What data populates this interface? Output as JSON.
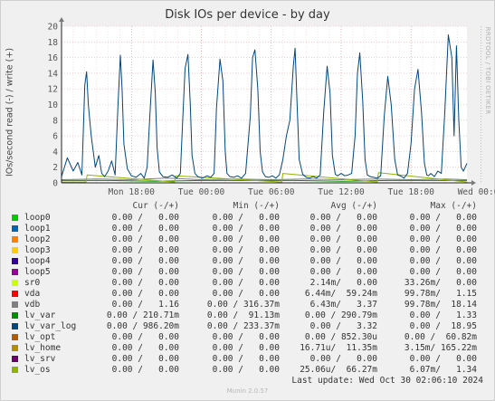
{
  "title": "Disk IOs per device - by day",
  "vendor": "RRDTOOL / TOBI OETIKER",
  "footer": {
    "last_update": "Last update: Wed Oct 30 02:06:10 2024",
    "munin": "Munin 2.0.57"
  },
  "legend_headers": [
    "Cur (-/+)",
    "Min (-/+)",
    "Avg (-/+)",
    "Max (-/+)"
  ],
  "series": [
    {
      "name": "loop0",
      "color": "#00cc00",
      "cur": "0.00 /   0.00",
      "min": "0.00 /   0.00",
      "avg": "0.00 /   0.00",
      "max": "0.00 /   0.00"
    },
    {
      "name": "loop1",
      "color": "#0066b3",
      "cur": "0.00 /   0.00",
      "min": "0.00 /   0.00",
      "avg": "0.00 /   0.00",
      "max": "0.00 /   0.00"
    },
    {
      "name": "loop2",
      "color": "#ff8000",
      "cur": "0.00 /   0.00",
      "min": "0.00 /   0.00",
      "avg": "0.00 /   0.00",
      "max": "0.00 /   0.00"
    },
    {
      "name": "loop3",
      "color": "#ffcc00",
      "cur": "0.00 /   0.00",
      "min": "0.00 /   0.00",
      "avg": "0.00 /   0.00",
      "max": "0.00 /   0.00"
    },
    {
      "name": "loop4",
      "color": "#330099",
      "cur": "0.00 /   0.00",
      "min": "0.00 /   0.00",
      "avg": "0.00 /   0.00",
      "max": "0.00 /   0.00"
    },
    {
      "name": "loop5",
      "color": "#990099",
      "cur": "0.00 /   0.00",
      "min": "0.00 /   0.00",
      "avg": "0.00 /   0.00",
      "max": "0.00 /   0.00"
    },
    {
      "name": "sr0",
      "color": "#ccff00",
      "cur": "0.00 /   0.00",
      "min": "0.00 /   0.00",
      "avg": "2.14m/   0.00",
      "max": "33.26m/   0.00"
    },
    {
      "name": "vda",
      "color": "#ff0000",
      "cur": "0.00 /   0.00",
      "min": "0.00 /   0.00",
      "avg": "6.44m/  59.24m",
      "max": "99.78m/   1.15"
    },
    {
      "name": "vdb",
      "color": "#808080",
      "cur": "0.00 /   1.16",
      "min": "0.00 / 316.37m",
      "avg": "6.43m/   3.37",
      "max": "99.78m/  18.14"
    },
    {
      "name": "lv_var",
      "color": "#008f00",
      "cur": "0.00 / 210.71m",
      "min": "0.00 /  91.13m",
      "avg": "0.00 / 290.79m",
      "max": "0.00 /   1.33"
    },
    {
      "name": "lv_var_log",
      "color": "#00487d",
      "cur": "0.00 / 986.20m",
      "min": "0.00 / 233.37m",
      "avg": "0.00 /   3.32",
      "max": "0.00 /  18.95"
    },
    {
      "name": "lv_opt",
      "color": "#b35a00",
      "cur": "0.00 /   0.00",
      "min": "0.00 /   0.00",
      "avg": "0.00 / 852.30u",
      "max": "0.00 /  60.82m"
    },
    {
      "name": "lv_home",
      "color": "#b38f00",
      "cur": "0.00 /   0.00",
      "min": "0.00 /   0.00",
      "avg": "16.71u/  11.35m",
      "max": "3.15m/ 165.22m"
    },
    {
      "name": "lv_srv",
      "color": "#6b006b",
      "cur": "0.00 /   0.00",
      "min": "0.00 /   0.00",
      "avg": "0.00 /   0.00",
      "max": "0.00 /   0.00"
    },
    {
      "name": "lv_os",
      "color": "#8fb300",
      "cur": "0.00 /   0.00",
      "min": "0.00 /   0.00",
      "avg": "25.06u/  66.27m",
      "max": "6.07m/   1.34"
    }
  ],
  "chart_data": {
    "type": "line",
    "title": "Disk IOs per device - by day",
    "ylabel": "IOs/second read (-) / write (+)",
    "xlabel": "",
    "ylim": [
      0,
      20
    ],
    "yticks": [
      "0",
      "2",
      "4",
      "6",
      "8",
      "10",
      "12",
      "14",
      "16",
      "18",
      "20"
    ],
    "xticks": [
      "Mon 18:00",
      "Tue 00:00",
      "Tue 06:00",
      "Tue 12:00",
      "Tue 18:00",
      "Wed 00:00"
    ],
    "x_unit": "hours since Mon 12:00",
    "grid": true,
    "series": [
      {
        "name": "lv_var_log",
        "color": "#00487d",
        "x": [
          0,
          0.5,
          1,
          1.4,
          1.75,
          2.0,
          2.15,
          2.3,
          2.55,
          2.9,
          3.2,
          3.45,
          3.7,
          4.0,
          4.3,
          4.6,
          4.85,
          5.05,
          5.2,
          5.35,
          5.65,
          6.0,
          6.4,
          6.8,
          7.1,
          7.35,
          7.6,
          7.85,
          8.05,
          8.2,
          8.4,
          8.7,
          9.1,
          9.5,
          9.9,
          10.2,
          10.4,
          10.6,
          10.85,
          11.05,
          11.2,
          11.45,
          11.7,
          12.1,
          12.5,
          12.8,
          13.1,
          13.3,
          13.6,
          13.85,
          14.05,
          14.2,
          14.45,
          14.8,
          15.1,
          15.45,
          15.8,
          16.2,
          16.4,
          16.6,
          16.85,
          17.05,
          17.25,
          17.5,
          17.8,
          18.1,
          18.4,
          18.7,
          19.0,
          19.3,
          19.6,
          19.9,
          20.05,
          20.2,
          20.4,
          20.7,
          21.0,
          21.3,
          21.6,
          21.9,
          22.2,
          22.5,
          22.8,
          23.05,
          23.25,
          23.5,
          23.7,
          24.0,
          24.3,
          24.6,
          24.9,
          25.2,
          25.4,
          25.6,
          25.85,
          26.05,
          26.25,
          26.5,
          26.8,
          27.1,
          27.4,
          27.7,
          28.0,
          28.3,
          28.6,
          28.85,
          29.05,
          29.2,
          29.4,
          29.7,
          30.0,
          30.3,
          30.6,
          30.9,
          31.15,
          31.35,
          31.5,
          31.7,
          32.0,
          32.3,
          32.6,
          32.9,
          33.2,
          33.5,
          33.7,
          33.9,
          34.1,
          34.3,
          34.5,
          34.8
        ],
        "values": [
          0.8,
          3.2,
          1.5,
          2.6,
          1.0,
          12.5,
          14.2,
          10.0,
          6.0,
          2.0,
          3.5,
          1.2,
          0.8,
          1.5,
          2.8,
          1.0,
          10.0,
          16.3,
          12.0,
          5.0,
          1.8,
          0.9,
          0.7,
          1.2,
          0.6,
          2.0,
          9.0,
          15.7,
          11.5,
          4.5,
          1.4,
          0.8,
          0.7,
          1.0,
          0.6,
          1.2,
          8.0,
          14.6,
          16.4,
          10.0,
          3.5,
          1.2,
          0.8,
          0.6,
          0.9,
          0.7,
          1.2,
          9.5,
          15.8,
          13.0,
          4.0,
          1.2,
          0.8,
          0.7,
          0.9,
          0.6,
          1.2,
          8.5,
          16.0,
          17.0,
          12.0,
          4.0,
          1.4,
          0.8,
          0.7,
          0.9,
          0.6,
          1.0,
          3.0,
          6.0,
          8.0,
          15.0,
          17.2,
          11.0,
          3.0,
          1.1,
          0.7,
          0.6,
          0.8,
          0.6,
          1.0,
          9.0,
          14.9,
          11.5,
          3.5,
          1.1,
          0.9,
          1.2,
          0.9,
          1.0,
          1.2,
          6.0,
          14.0,
          16.6,
          10.5,
          3.0,
          1.0,
          0.8,
          0.7,
          0.6,
          0.9,
          8.5,
          13.6,
          10.0,
          3.0,
          1.0,
          0.9,
          0.8,
          0.6,
          1.2,
          5.0,
          12.0,
          14.5,
          9.0,
          2.5,
          1.0,
          0.9,
          1.2,
          0.8,
          1.5,
          1.2,
          9.0,
          18.9,
          16.0,
          6.0,
          17.5,
          8.0,
          2.0,
          1.5,
          2.5
        ]
      },
      {
        "name": "vdb",
        "color": "#808080",
        "x": [
          0,
          3,
          6,
          9,
          12,
          15,
          18,
          21,
          24,
          27,
          30,
          33,
          34.8
        ],
        "values": [
          0.4,
          0.5,
          0.4,
          0.6,
          0.4,
          0.5,
          0.4,
          0.5,
          0.4,
          0.5,
          0.4,
          0.5,
          0.4
        ]
      },
      {
        "name": "lv_var",
        "color": "#008f00",
        "x": [
          0,
          4,
          8,
          12,
          16,
          20,
          24,
          28,
          32,
          34.8
        ],
        "values": [
          0.3,
          0.3,
          0.2,
          0.3,
          0.3,
          0.3,
          0.2,
          0.3,
          0.3,
          0.3
        ]
      },
      {
        "name": "lv_os",
        "color": "#8fb300",
        "x": [
          0,
          2.1,
          2.2,
          9.7,
          9.8,
          18.9,
          19.0,
          27.1,
          27.2,
          34.8
        ],
        "values": [
          0.1,
          0.1,
          1.0,
          0.1,
          0.9,
          0.1,
          1.2,
          0.1,
          1.3,
          0.1
        ]
      }
    ]
  }
}
